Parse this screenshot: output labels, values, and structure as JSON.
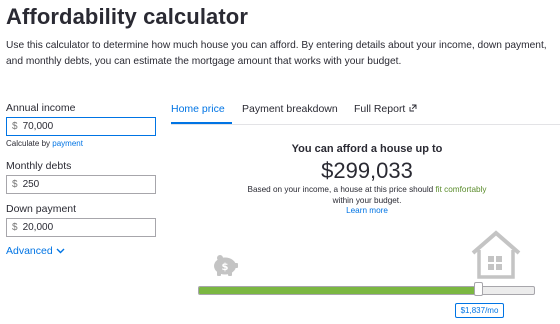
{
  "title": "Affordability calculator",
  "intro": "Use this calculator to determine how much house you can afford. By entering details about your income, down payment, and monthly debts, you can estimate the mortgage amount that works with your budget.",
  "inputs": {
    "annual_income": {
      "label": "Annual income",
      "currency": "$",
      "value": "70,000"
    },
    "calculate_by": {
      "prefix": "Calculate by",
      "link": "payment"
    },
    "monthly_debts": {
      "label": "Monthly debts",
      "currency": "$",
      "value": "250"
    },
    "down_payment": {
      "label": "Down payment",
      "currency": "$",
      "value": "20,000"
    },
    "advanced_label": "Advanced"
  },
  "tabs": [
    {
      "label": "Home price",
      "active": true
    },
    {
      "label": "Payment breakdown",
      "active": false
    },
    {
      "label": "Full Report",
      "active": false
    }
  ],
  "result": {
    "heading": "You can afford a house up to",
    "amount": "$299,033",
    "desc_before": "Based on your income, a house at this price should",
    "desc_highlight": "fit comfortably",
    "desc_after": "within your budget.",
    "learn_more": "Learn more"
  },
  "slider": {
    "fill_fraction": 0.83,
    "payment_label": "$1,837/mo"
  },
  "colors": {
    "accent": "#0074e4",
    "slider_fill": "#7bb742",
    "highlight_text": "#5a8c2b"
  },
  "icons": {
    "savings": "piggy-bank-icon",
    "house": "house-icon",
    "advanced": "chevron-down-icon",
    "external": "external-link-icon"
  }
}
